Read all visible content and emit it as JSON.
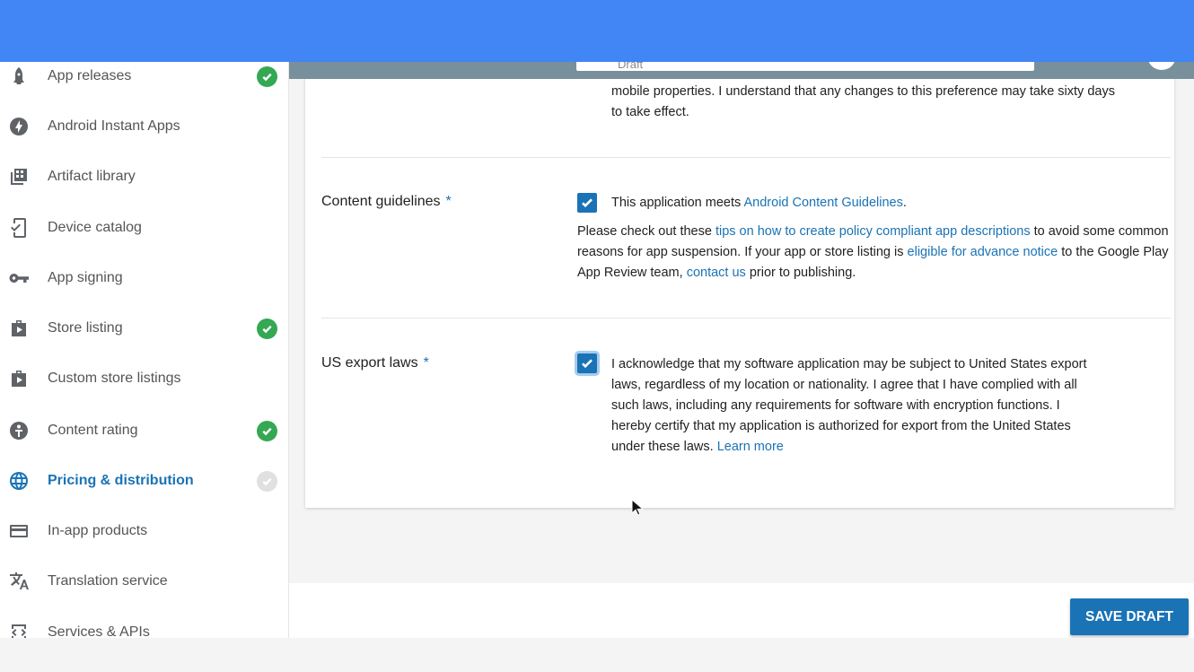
{
  "appbar": {
    "draft_label": "Draft"
  },
  "sidebar": {
    "items": [
      {
        "label": "App releases",
        "icon": "rocket-icon",
        "status": "done"
      },
      {
        "label": "Android Instant Apps",
        "icon": "bolt-icon",
        "status": ""
      },
      {
        "label": "Artifact library",
        "icon": "grid-icon",
        "status": ""
      },
      {
        "label": "Device catalog",
        "icon": "device-check-icon",
        "status": ""
      },
      {
        "label": "App signing",
        "icon": "key-icon",
        "status": ""
      },
      {
        "label": "Store listing",
        "icon": "store-play-icon",
        "status": "done"
      },
      {
        "label": "Custom store listings",
        "icon": "store-play-icon",
        "status": ""
      },
      {
        "label": "Content rating",
        "icon": "content-rating-icon",
        "status": "done"
      },
      {
        "label": "Pricing & distribution",
        "icon": "globe-icon",
        "status": "pending",
        "active": true
      },
      {
        "label": "In-app products",
        "icon": "card-icon",
        "status": ""
      },
      {
        "label": "Translation service",
        "icon": "translate-icon",
        "status": ""
      },
      {
        "label": "Services & APIs",
        "icon": "code-icon",
        "status": ""
      }
    ]
  },
  "main": {
    "top_para": {
      "line1": "mobile properties. I understand that any changes to this preference may take sixty days",
      "line2": "to take effect."
    },
    "content_guidelines": {
      "label": "Content guidelines",
      "required": "*",
      "checked": true,
      "check_text": "This application meets ",
      "check_link": "Android Content Guidelines",
      "check_end": ".",
      "para_1": "Please check out these ",
      "link_tips": "tips on how to create policy compliant app descriptions",
      "para_2": " to avoid some common reasons for app suspension. If your app or store listing is ",
      "link_eligible": "eligible for advance notice",
      "para_3": " to the Google Play App Review team, ",
      "link_contact": "contact us",
      "para_4": " prior to publishing."
    },
    "us_export": {
      "label": "US export laws",
      "required": "*",
      "checked": true,
      "text": "I acknowledge that my software application may be subject to United States export laws, regardless of my location or nationality. I agree that I have complied with all such laws, including any requirements for software with encryption functions. I hereby certify that my application is authorized for export from the United States under these laws. ",
      "learn_more": "Learn more"
    }
  },
  "footer": {
    "save_label": "SAVE DRAFT"
  },
  "colors": {
    "accent": "#1a73b5",
    "done": "#34a853",
    "top_band": "#4285f4",
    "appbar": "#78909c"
  }
}
